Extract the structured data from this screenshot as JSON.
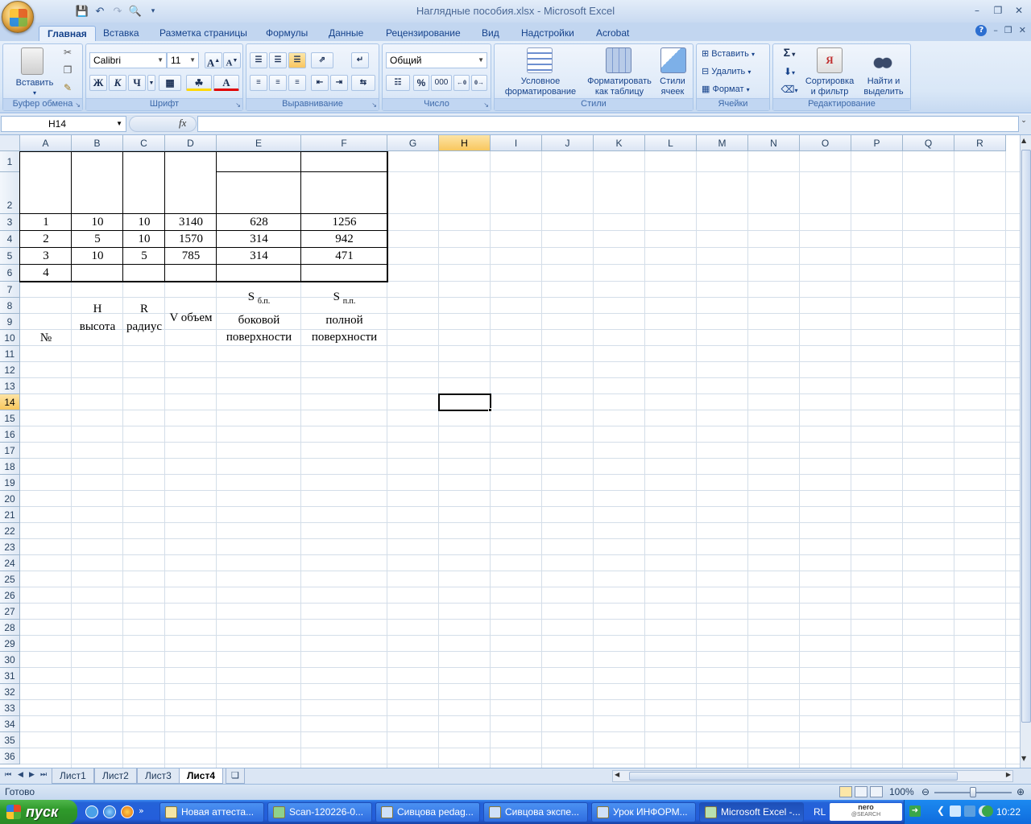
{
  "window": {
    "title": "Наглядные пособия.xlsx - Microsoft Excel"
  },
  "ribbon": {
    "tabs": [
      "Главная",
      "Вставка",
      "Разметка страницы",
      "Формулы",
      "Данные",
      "Рецензирование",
      "Вид",
      "Надстройки",
      "Acrobat"
    ],
    "active_tab": "Главная",
    "clipboard": {
      "paste": "Вставить",
      "label": "Буфер обмена"
    },
    "font": {
      "name": "Calibri",
      "size": "11",
      "bold": "Ж",
      "italic": "К",
      "underline": "Ч",
      "grow": "A",
      "shrink": "A",
      "label": "Шрифт"
    },
    "alignment": {
      "label": "Выравнивание"
    },
    "number": {
      "format": "Общий",
      "percent": "%",
      "thousands": "000",
      "label": "Число"
    },
    "styles": {
      "conditional": "Условное форматирование",
      "as_table": "Форматировать как таблицу",
      "cell_styles": "Стили ячеек",
      "label": "Стили"
    },
    "cells": {
      "insert": "Вставить",
      "delete": "Удалить",
      "format": "Формат",
      "label": "Ячейки"
    },
    "editing": {
      "sum": "Σ",
      "sort": "Сортировка и фильтр",
      "find": "Найти и выделить",
      "label": "Редактирование"
    }
  },
  "formula_bar": {
    "name_box": "H14",
    "fx": "fx",
    "content": ""
  },
  "columns": [
    "A",
    "B",
    "C",
    "D",
    "E",
    "F",
    "G",
    "H",
    "I",
    "J",
    "K",
    "L",
    "M",
    "N",
    "O",
    "P",
    "Q",
    "R"
  ],
  "selected_column": "H",
  "rows": [
    "1",
    "2",
    "3",
    "4",
    "5",
    "6",
    "7",
    "8",
    "9",
    "10",
    "11",
    "12",
    "13",
    "14",
    "15",
    "16",
    "17",
    "18",
    "19",
    "20",
    "21",
    "22",
    "23",
    "24",
    "25",
    "26",
    "27",
    "28",
    "29",
    "30",
    "31",
    "32",
    "33",
    "34",
    "35",
    "36"
  ],
  "selected_row": "14",
  "table": {
    "header": {
      "a": "№",
      "b_top": "H",
      "b_bottom": "высота",
      "c_top": "R",
      "c_bottom": "радиус",
      "d": "V объем",
      "e_top": "S",
      "e_sub": "б.п.",
      "e_bottom1": "боковой",
      "e_bottom2": "поверхности",
      "f_top": "S",
      "f_sub": "п.п.",
      "f_bottom1": "полной",
      "f_bottom2": "поверхности"
    },
    "rows": [
      [
        "1",
        "10",
        "10",
        "3140",
        "628",
        "1256"
      ],
      [
        "2",
        "5",
        "10",
        "1570",
        "314",
        "942"
      ],
      [
        "3",
        "10",
        "5",
        "785",
        "314",
        "471"
      ],
      [
        "4",
        "",
        "",
        "",
        "",
        ""
      ]
    ]
  },
  "sheets": [
    "Лист1",
    "Лист2",
    "Лист3",
    "Лист4"
  ],
  "active_sheet": "Лист4",
  "status": {
    "text": "Готово",
    "zoom": "100%"
  },
  "taskbar": {
    "start": "пуск",
    "items": [
      "Новая аттеста...",
      "Scan-120226-0...",
      "Сивцова pedag...",
      "Сивцова экспе...",
      "Урок ИНФОРМ...",
      "Microsoft Excel -..."
    ],
    "lang": "RL",
    "nero": "nero",
    "nero_sub": "@SEARCH",
    "clock": "10:22"
  }
}
